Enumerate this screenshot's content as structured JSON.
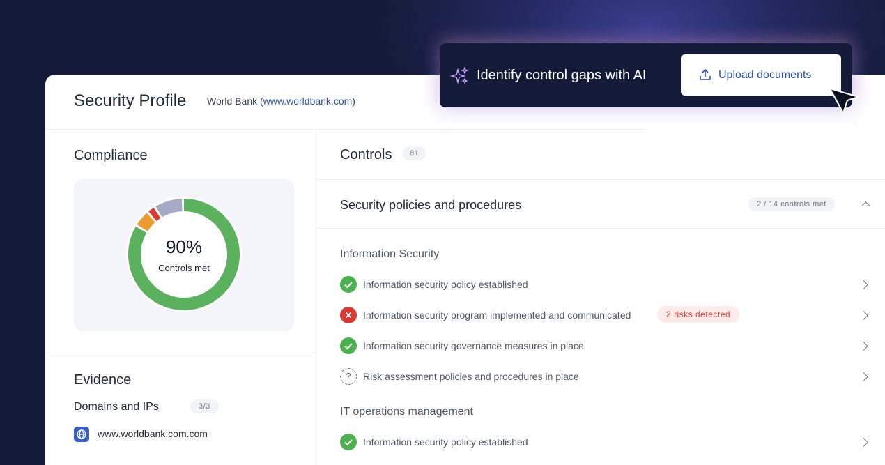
{
  "header": {
    "title": "Security Profile",
    "org_name": "World Bank (",
    "org_link": "www.worldbank.com",
    "org_close": ")"
  },
  "compliance": {
    "title": "Compliance",
    "percent_text": "90%",
    "label": "Controls met",
    "segments": [
      {
        "status": "met",
        "fraction": 0.84,
        "color": "#5bb15e"
      },
      {
        "status": "partial",
        "fraction": 0.05,
        "color": "#ee9a33"
      },
      {
        "status": "failed",
        "fraction": 0.025,
        "color": "#d83a34"
      },
      {
        "status": "unknown",
        "fraction": 0.085,
        "color": "#a6aac4"
      }
    ]
  },
  "evidence": {
    "title": "Evidence",
    "domains_label": "Domains and IPs",
    "domains_count": "3/3",
    "domain_items": [
      "www.worldbank.com.com"
    ]
  },
  "controls": {
    "title": "Controls",
    "count": "81",
    "category": "Security policies and procedures",
    "category_status": "2 / 14 controls met",
    "groups": [
      {
        "name": "Information Security",
        "items": [
          {
            "label": "Information security policy established",
            "status": "ok"
          },
          {
            "label": "Information security program implemented and communicated",
            "status": "bad",
            "badge": "2 risks detected"
          },
          {
            "label": "Information security governance measures in place",
            "status": "ok"
          },
          {
            "label": "Risk assessment policies and procedures in place",
            "status": "unknown"
          }
        ]
      },
      {
        "name": "IT operations management",
        "items": [
          {
            "label": "Information security policy established",
            "status": "ok"
          }
        ]
      }
    ]
  },
  "banner": {
    "text": "Identify control gaps with AI",
    "button_label": "Upload documents"
  },
  "colors": {
    "accent": "#2f4fa8",
    "ok": "#4caf50",
    "danger": "#d83a34",
    "background": "#141b38"
  }
}
